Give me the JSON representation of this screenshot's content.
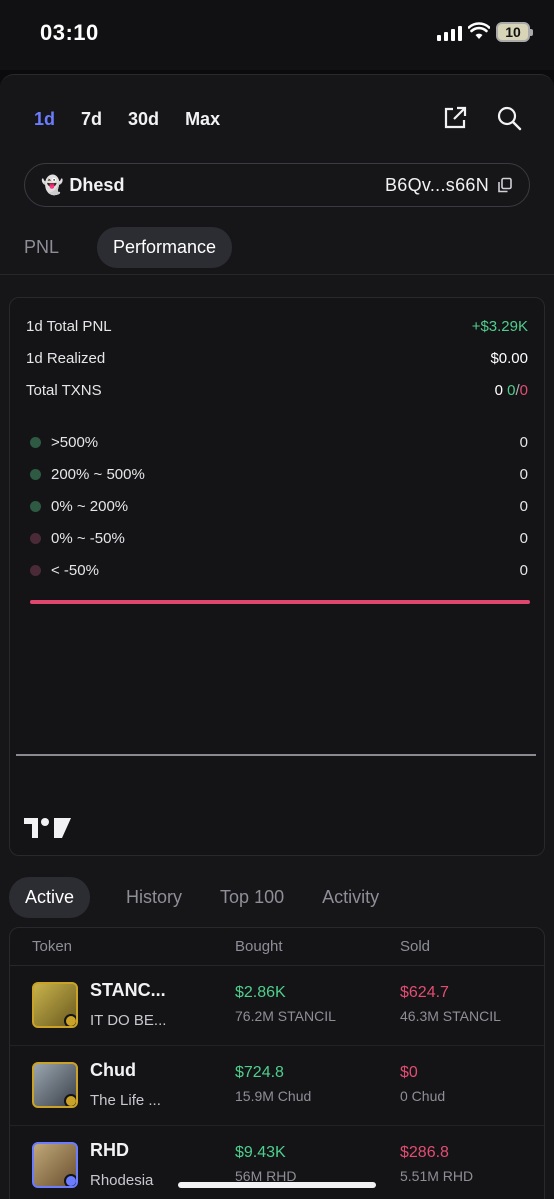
{
  "status_bar": {
    "time": "03:10",
    "battery": "10"
  },
  "ranges": [
    {
      "label": "1d",
      "active": true
    },
    {
      "label": "7d",
      "active": false
    },
    {
      "label": "30d",
      "active": false
    },
    {
      "label": "Max",
      "active": false
    }
  ],
  "wallet": {
    "emoji": "👻",
    "name": "Dhesd",
    "address": "B6Qv...s66N"
  },
  "subtabs": {
    "pnl": "PNL",
    "performance": "Performance"
  },
  "summary": {
    "total_pnl_label": "1d Total PNL",
    "total_pnl_value": "+$3.29K",
    "realized_label": "1d Realized",
    "realized_value": "$0.00",
    "txns_label": "Total TXNS",
    "txns_total": "0",
    "txns_buy": "0",
    "txns_sep": "/",
    "txns_sell": "0"
  },
  "distribution": [
    {
      "label": ">500%",
      "count": "0",
      "color": "#2e5a44"
    },
    {
      "label": "200% ~ 500%",
      "count": "0",
      "color": "#2e5a44"
    },
    {
      "label": "0% ~ 200%",
      "count": "0",
      "color": "#2e5a44"
    },
    {
      "label": "0% ~ -50%",
      "count": "0",
      "color": "#4a2a36"
    },
    {
      "label": "< -50%",
      "count": "0",
      "color": "#4a2a36"
    }
  ],
  "list_tabs": {
    "active": "Active",
    "history": "History",
    "top100": "Top 100",
    "activity": "Activity"
  },
  "table": {
    "headers": {
      "token": "Token",
      "bought": "Bought",
      "sold": "Sold"
    },
    "rows": [
      {
        "name": "STANC...",
        "sub": "IT DO BE...",
        "bought": "$2.86K",
        "bought_qty": "76.2M STANCIL",
        "sold": "$624.7",
        "sold_qty": "46.3M STANCIL"
      },
      {
        "name": "Chud",
        "sub": "The Life ...",
        "bought": "$724.8",
        "bought_qty": "15.9M Chud",
        "sold": "$0",
        "sold_qty": "0 Chud"
      },
      {
        "name": "RHD",
        "sub": "Rhodesia",
        "bought": "$9.43K",
        "bought_qty": "56M RHD",
        "sold": "$286.8",
        "sold_qty": "5.51M RHD"
      }
    ]
  },
  "colors": {
    "accent": "#6b7cff",
    "positive": "#4fce8c",
    "negative": "#e24d72"
  }
}
